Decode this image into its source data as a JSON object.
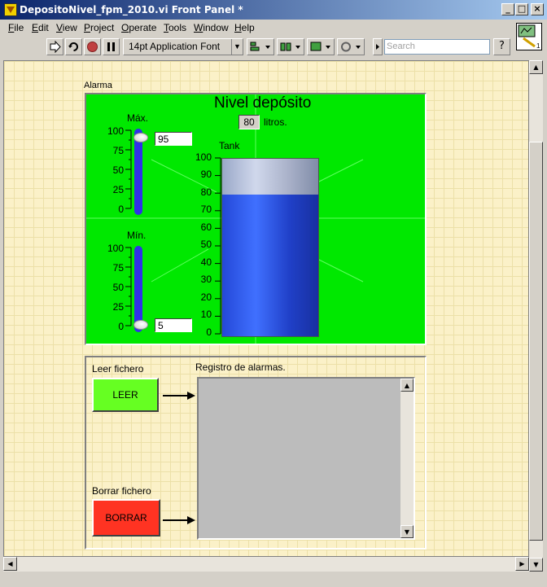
{
  "window": {
    "title": "DepositoNivel_fpm_2010.vi Front Panel *",
    "icon": "labview-vi-icon",
    "buttons": [
      "minimize-icon",
      "maximize-icon",
      "close-icon"
    ]
  },
  "menu": [
    {
      "label": "File",
      "accel": "F",
      "rest": "ile"
    },
    {
      "label": "Edit",
      "accel": "E",
      "rest": "dit"
    },
    {
      "label": "View",
      "accel": "V",
      "rest": "iew"
    },
    {
      "label": "Project",
      "accel": "P",
      "rest": "roject"
    },
    {
      "label": "Operate",
      "accel": "O",
      "rest": "perate"
    },
    {
      "label": "Tools",
      "accel": "T",
      "rest": "ools"
    },
    {
      "label": "Window",
      "accel": "W",
      "rest": "indow"
    },
    {
      "label": "Help",
      "accel": "H",
      "rest": "elp"
    }
  ],
  "toolbar": {
    "font_label": "14pt Application Font",
    "search_placeholder": "Search",
    "help_label": "?"
  },
  "alarm_cluster": {
    "label": "Alarma",
    "title": "Nivel depósito",
    "level_value": "80",
    "level_unit": "litros.",
    "tank_label": "Tank",
    "tank_level_percent": 80,
    "max": {
      "label": "Máx.",
      "value": "95",
      "level_percent": 95
    },
    "min": {
      "label": "Mín.",
      "value": "5",
      "level_percent": 5
    },
    "slider_scale": [
      "100",
      "75",
      "50",
      "25",
      "0"
    ],
    "tank_scale": [
      "100",
      "90",
      "80",
      "70",
      "60",
      "50",
      "40",
      "30",
      "20",
      "10",
      "0"
    ]
  },
  "log_cluster": {
    "read_label": "Leer fichero",
    "read_button": "LEER",
    "read_color": "#66ff22",
    "clear_label": "Borrar fichero",
    "clear_button": "BORRAR",
    "clear_color": "#ff3322",
    "log_label": "Registro de alarmas.",
    "log_text": ""
  },
  "colors": {
    "panel_bg": "#fbf1c8",
    "cluster_green": "#00e800",
    "tank_blue": "#2448d8"
  }
}
